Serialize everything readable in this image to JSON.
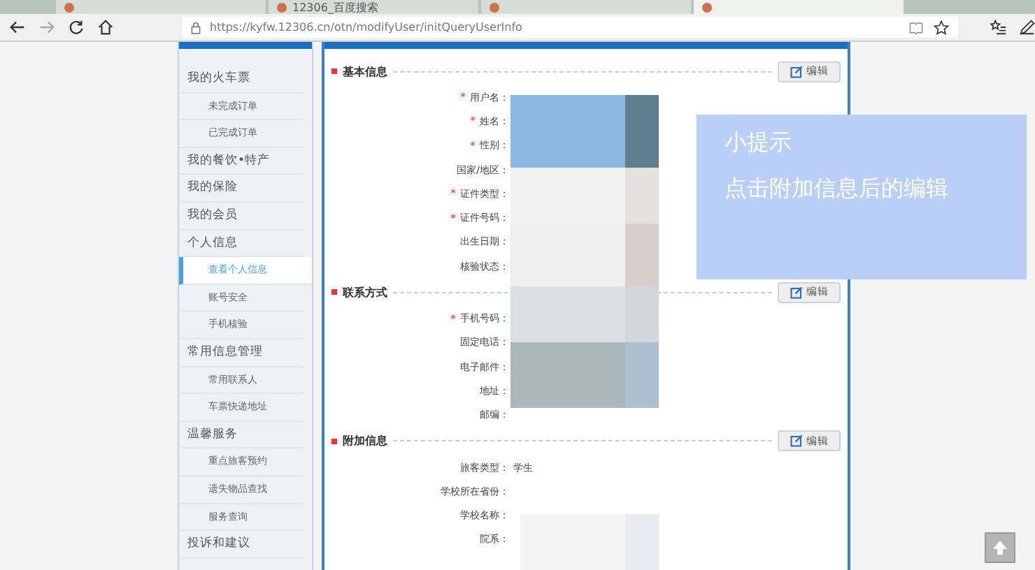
{
  "browser": {
    "tabs": [
      {
        "selected": false
      },
      {
        "title": "12306_百度搜索",
        "selected": false
      },
      {
        "selected": false
      },
      {
        "selected": true
      }
    ],
    "address": "https://kyfw.12306.cn/otn/modifyUser/initQueryUserInfo"
  },
  "sidebar": {
    "items": [
      {
        "label": "我的火车票",
        "selected": false,
        "children": [
          {
            "label": "未完成订单",
            "selected": false
          },
          {
            "label": "已完成订单",
            "selected": false
          }
        ]
      },
      {
        "label": "我的餐饮•特产",
        "selected": false
      },
      {
        "label": "我的保险",
        "selected": false
      },
      {
        "label": "我的会员",
        "selected": false
      },
      {
        "label": "个人信息",
        "selected": false,
        "children": [
          {
            "label": "查看个人信息",
            "selected": true
          },
          {
            "label": "账号安全",
            "selected": false
          },
          {
            "label": "手机核验",
            "selected": false
          }
        ]
      },
      {
        "label": "常用信息管理",
        "selected": false,
        "children": [
          {
            "label": "常用联系人",
            "selected": false
          },
          {
            "label": "车票快递地址",
            "selected": false
          }
        ]
      },
      {
        "label": "温馨服务",
        "selected": false,
        "children": [
          {
            "label": "重点旅客预约",
            "selected": false
          },
          {
            "label": "遗失物品查找",
            "selected": false
          },
          {
            "label": "服务查询",
            "selected": false
          }
        ]
      },
      {
        "label": "投诉和建议",
        "selected": false
      }
    ]
  },
  "sections": [
    {
      "title": "基本信息",
      "edit": "编辑",
      "fields": [
        {
          "label": "用户名：",
          "mark": "*"
        },
        {
          "label": "姓名：",
          "mark": "*"
        },
        {
          "label": "性别：",
          "mark": "*"
        },
        {
          "label": "国家/地区："
        },
        {
          "label": "证件类型：",
          "mark": "*"
        },
        {
          "label": "证件号码：",
          "mark": "*"
        },
        {
          "label": "出生日期："
        },
        {
          "label": "核验状态："
        }
      ]
    },
    {
      "title": "联系方式",
      "edit": "编辑",
      "fields": [
        {
          "label": "手机号码：",
          "mark": "*"
        },
        {
          "label": "固定电话："
        },
        {
          "label": "电子邮件："
        },
        {
          "label": "地址："
        },
        {
          "label": "邮编："
        }
      ]
    },
    {
      "title": "附加信息",
      "edit": "编辑",
      "fields": [
        {
          "label": "旅客类型：",
          "value": "学生"
        },
        {
          "label": "学校所在省份："
        },
        {
          "label": "学校名称："
        },
        {
          "label": "院系："
        }
      ]
    }
  ],
  "tip": {
    "title": "小提示",
    "text": "点击附加信息后的编辑"
  }
}
